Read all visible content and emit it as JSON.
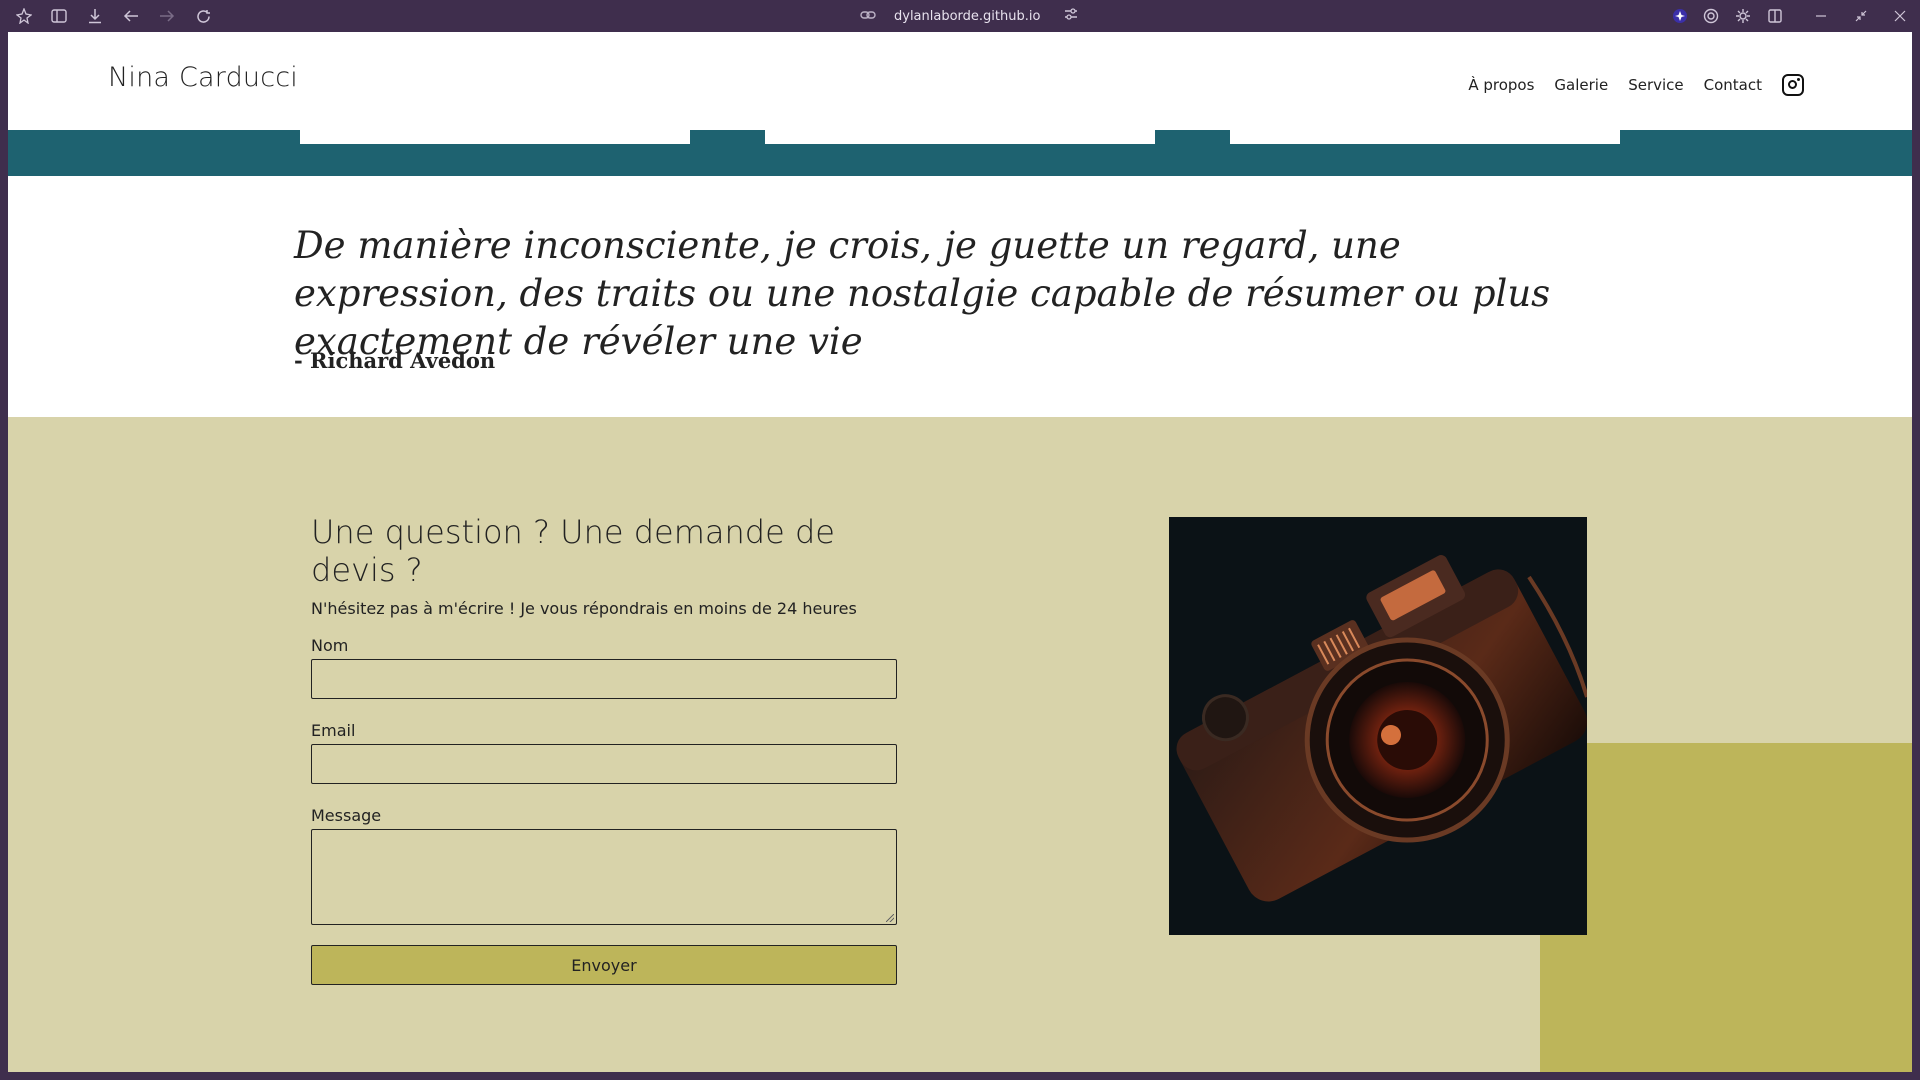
{
  "browser": {
    "url": "dylanlaborde.github.io",
    "icons": [
      "extensions-icon",
      "sidebar-icon",
      "download-icon",
      "back-arrow-icon",
      "forward-arrow-icon",
      "reload-icon",
      "link-icon",
      "site-settings-icon",
      "shield-icon",
      "target-icon",
      "gear-icon",
      "split-view-icon",
      "minimize-icon",
      "restore-icon",
      "close-icon"
    ]
  },
  "header": {
    "brand": "Nina Carducci",
    "nav": [
      "À propos",
      "Galerie",
      "Service",
      "Contact"
    ],
    "instagram_icon": "instagram-icon"
  },
  "quote": {
    "text": "De manière inconsciente, je crois, je guette un regard, une expression, des traits ou une nostalgie capable de résumer ou plus exactement de révéler une vie",
    "author": "- Richard Avedon"
  },
  "contact": {
    "title": "Une question ? Une demande de devis ?",
    "subtitle": "N'hésitez pas à m'écrire ! Je vous répondrais en moins de 24 heures",
    "name_label": "Nom",
    "email_label": "Email",
    "message_label": "Message",
    "name_value": "",
    "email_value": "",
    "message_value": "",
    "submit_label": "Envoyer"
  },
  "colors": {
    "chrome": "#3f2e4d",
    "teal": "#1e6270",
    "sand": "#d8d3aa",
    "olive": "#bdb55a"
  }
}
